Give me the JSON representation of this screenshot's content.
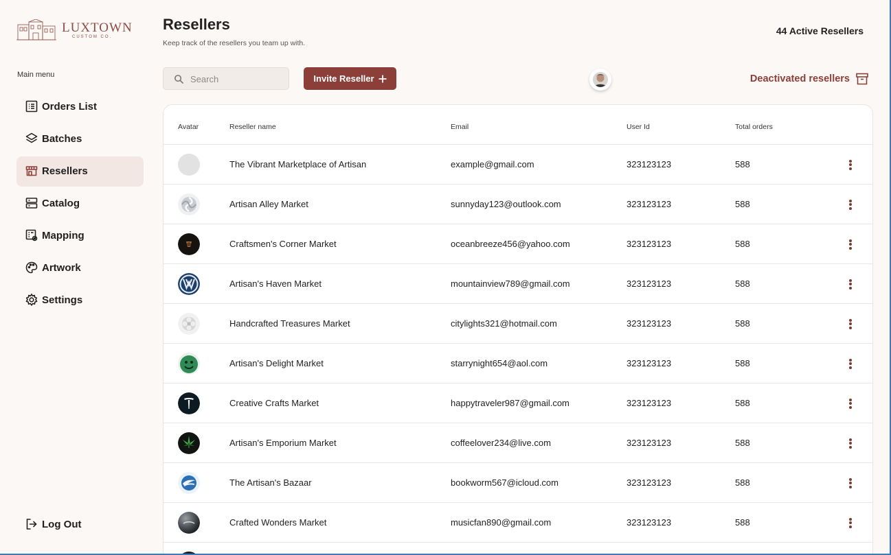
{
  "brand": {
    "name": "LUXTOWN",
    "tagline": "CUSTOM CO."
  },
  "sidebar": {
    "menu_title": "Main menu",
    "items": [
      {
        "label": "Orders List",
        "icon": "list-icon",
        "active": false
      },
      {
        "label": "Batches",
        "icon": "layers-icon",
        "active": false
      },
      {
        "label": "Resellers",
        "icon": "store-icon",
        "active": true
      },
      {
        "label": "Catalog",
        "icon": "catalog-icon",
        "active": false
      },
      {
        "label": "Mapping",
        "icon": "mapping-icon",
        "active": false
      },
      {
        "label": "Artwork",
        "icon": "palette-icon",
        "active": false
      },
      {
        "label": "Settings",
        "icon": "gear-icon",
        "active": false
      }
    ],
    "logout_label": "Log Out"
  },
  "header": {
    "title": "Resellers",
    "subtitle": "Keep track of the resellers you team up with.",
    "active_count": "44 Active Resellers"
  },
  "toolbar": {
    "search_placeholder": "Search",
    "invite_label": "Invite Reseller",
    "deactivated_label": "Deactivated resellers"
  },
  "table": {
    "columns": [
      "Avatar",
      "Reseller name",
      "Email",
      "User Id",
      "Total orders"
    ],
    "rows": [
      {
        "name": "The Vibrant Marketplace of Artisan",
        "email": "example@gmail.com",
        "user_id": "323123123",
        "orders": "588",
        "avatar": "gray-placeholder"
      },
      {
        "name": "Artisan Alley Market",
        "email": "sunnyday123@outlook.com",
        "user_id": "323123123",
        "orders": "588",
        "avatar": "silver-swirl-logo"
      },
      {
        "name": "Craftsmen's Corner Market",
        "email": "oceanbreeze456@yahoo.com",
        "user_id": "323123123",
        "orders": "588",
        "avatar": "dark-emblem-logo"
      },
      {
        "name": "Artisan's Haven Market",
        "email": "mountainview789@gmail.com",
        "user_id": "323123123",
        "orders": "588",
        "avatar": "vw-logo"
      },
      {
        "name": "Handcrafted Treasures Market",
        "email": "citylights321@hotmail.com",
        "user_id": "323123123",
        "orders": "588",
        "avatar": "silver-flower-logo"
      },
      {
        "name": "Artisan's Delight Market",
        "email": "starrynight654@aol.com",
        "user_id": "323123123",
        "orders": "588",
        "avatar": "green-face-logo"
      },
      {
        "name": "Creative Crafts Market",
        "email": "happytraveler987@gmail.com",
        "user_id": "323123123",
        "orders": "588",
        "avatar": "tesla-logo"
      },
      {
        "name": "Artisan's Emporium Market",
        "email": "coffeelover234@live.com",
        "user_id": "323123123",
        "orders": "588",
        "avatar": "leaf-logo"
      },
      {
        "name": "The Artisan's Bazaar",
        "email": "bookworm567@icloud.com",
        "user_id": "323123123",
        "orders": "588",
        "avatar": "blue-wing-logo"
      },
      {
        "name": "Crafted Wonders Market",
        "email": "musicfan890@gmail.com",
        "user_id": "323123123",
        "orders": "588",
        "avatar": "metal-sphere-logo"
      },
      {
        "name": "",
        "email": "",
        "user_id": "",
        "orders": "",
        "avatar": "dark-placeholder"
      }
    ]
  },
  "colors": {
    "accent": "#8c3f38",
    "active_nav_bg": "#f2e7e3",
    "page_bg": "#fcf8f5"
  }
}
